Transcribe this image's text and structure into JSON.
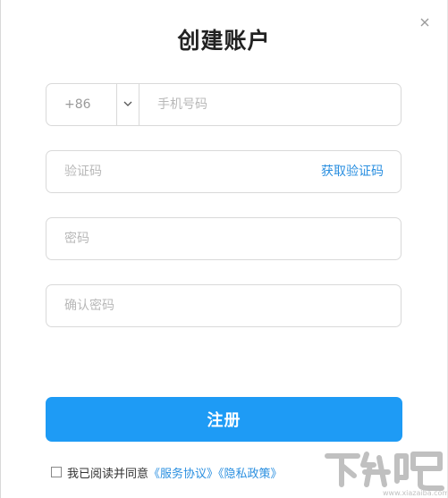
{
  "dialog": {
    "title": "创建账户",
    "close_icon": "close-icon"
  },
  "form": {
    "phone": {
      "country_code": "+86",
      "dropdown_icon": "chevron-down-icon",
      "placeholder": "手机号码",
      "value": ""
    },
    "verification": {
      "placeholder": "验证码",
      "value": "",
      "get_code_label": "获取验证码"
    },
    "password": {
      "placeholder": "密码",
      "value": ""
    },
    "confirm_password": {
      "placeholder": "确认密码",
      "value": ""
    },
    "register_label": "注册"
  },
  "agreement": {
    "checked": false,
    "text": "我已阅读并同意",
    "service_link": "《服务协议》",
    "privacy_link": "《隐私政策》"
  },
  "watermark": {
    "text": "下载吧",
    "domain": "www.xiazaiba.com"
  },
  "colors": {
    "accent": "#1e9bf5",
    "link": "#2a8fe0",
    "border": "#d9d9d9",
    "placeholder": "#b8b8b8"
  }
}
